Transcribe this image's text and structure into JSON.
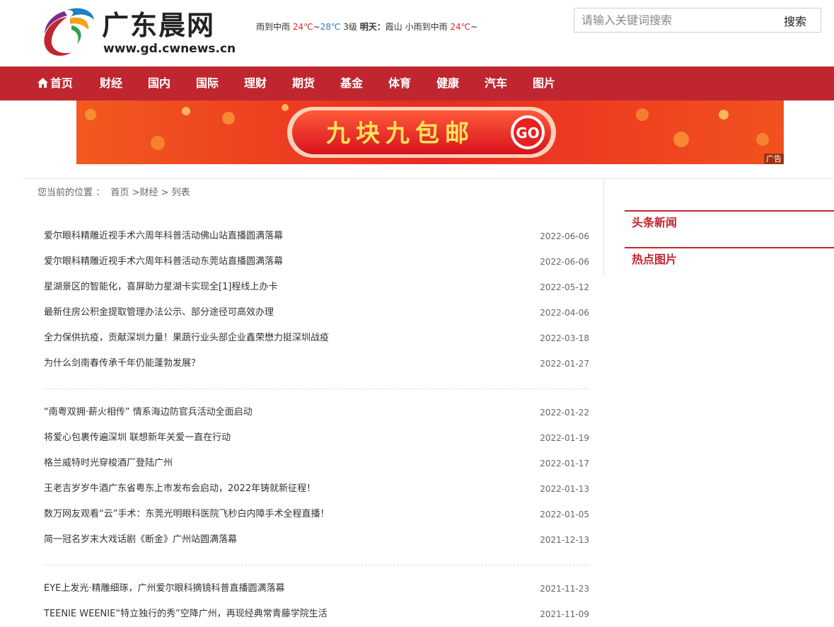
{
  "site": {
    "name": "广东晨网",
    "url": "www.gd.cwnews.cn"
  },
  "weather": {
    "today_cond": "雨到中雨",
    "temp_high": "24℃",
    "sep": "~",
    "temp_low": "28℃",
    "wind": "3级",
    "tomorrow_label": "明天：",
    "tomorrow_city": "霞山",
    "tomorrow_cond": "小雨到中雨",
    "tomorrow_temp": "24℃",
    "tail": "~"
  },
  "search": {
    "placeholder": "请输入关键词搜索",
    "button": "搜索"
  },
  "nav": [
    "首页",
    "财经",
    "国内",
    "国际",
    "理财",
    "期货",
    "基金",
    "体育",
    "健康",
    "汽车",
    "图片"
  ],
  "banner": {
    "text": "九块九包邮",
    "go": "GO",
    "ad_label": "广告"
  },
  "breadcrumb": {
    "prefix": "您当前的位置 ：",
    "home": "首页",
    "sep1": ">",
    "section": "财经",
    "sep2": ">",
    "current": "列表"
  },
  "articles": [
    [
      {
        "title": "爱尔眼科精雕近视手术六周年科普活动佛山站直播圆满落幕",
        "date": "2022-06-06"
      },
      {
        "title": "爱尔眼科精雕近视手术六周年科普活动东莞站直播圆满落幕",
        "date": "2022-06-06"
      },
      {
        "title": "星湖景区的智能化，喜屏助力星湖卡实现全[1]程线上办卡",
        "date": "2022-05-12"
      },
      {
        "title": "最新住房公积金提取管理办法公示、部分途径可高效办理",
        "date": "2022-04-06"
      },
      {
        "title": "全力保供抗疫，贡献深圳力量！果蔬行业头部企业鑫荣懋力挺深圳战疫",
        "date": "2022-03-18"
      },
      {
        "title": "为什么剑南春传承千年仍能蓬勃发展？",
        "date": "2022-01-27"
      }
    ],
    [
      {
        "title": "“南粤双拥·薪火相传” 情系海边防官兵活动全面启动",
        "date": "2022-01-22"
      },
      {
        "title": "将爱心包裹传遍深圳 联想新年关爱一直在行动",
        "date": "2022-01-19"
      },
      {
        "title": "格兰威特时光穿梭酒厂登陆广州",
        "date": "2022-01-17"
      },
      {
        "title": "王老吉岁岁牛酒广东省粤东上市发布会启动，2022年铸就新征程！",
        "date": "2022-01-13"
      },
      {
        "title": "数万网友观看“云”手术：东莞光明眼科医院飞秒白内障手术全程直播！",
        "date": "2022-01-05"
      },
      {
        "title": "简一冠名岁末大戏话剧《断金》广州站圆满落幕",
        "date": "2021-12-13"
      }
    ],
    [
      {
        "title": "EYE上发光·精雕细琢，广州爱尔眼科摘镜科普直播圆满落幕",
        "date": "2021-11-23"
      },
      {
        "title": "TEENIE WEENIE“特立独行的秀”空降广州，再现经典常青藤学院生活",
        "date": "2021-11-09"
      }
    ]
  ],
  "sidebar": {
    "headline": "头条新闻",
    "photos": "热点图片"
  },
  "colors": {
    "brand_red": "#c0262f",
    "temp_warm": "#d92a2a",
    "temp_cool": "#3b78c5"
  },
  "icons": [
    "home-icon",
    "logo-swirl-icon"
  ]
}
